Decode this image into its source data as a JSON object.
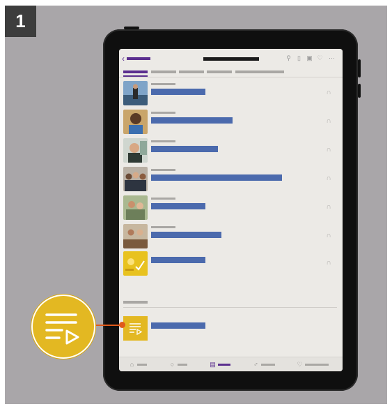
{
  "step": {
    "number": "1"
  },
  "colors": {
    "background": "#a9a6a9",
    "accent": "#5b2f8f",
    "title_placeholder": "#4b6aad",
    "highlight": "#e3b822",
    "callout_line": "#e05a1a"
  },
  "topbar": {
    "icons": [
      "back-chevron-icon",
      "search-icon",
      "bookmark-icon",
      "cast-icon",
      "lightbulb-icon",
      "more-icon"
    ]
  },
  "episodes": [
    {
      "thumb": "person-outdoors"
    },
    {
      "thumb": "man-smiling"
    },
    {
      "thumb": "woman-smiling"
    },
    {
      "thumb": "group-of-people"
    },
    {
      "thumb": "people-talking"
    },
    {
      "thumb": "people-at-table"
    },
    {
      "thumb": "yellow-illustration"
    }
  ],
  "playlist": {
    "icon": "playlist-icon"
  },
  "bottomnav": {
    "items": [
      {
        "icon": "home-icon",
        "active": false
      },
      {
        "icon": "comment-icon",
        "active": false
      },
      {
        "icon": "library-icon",
        "active": true
      },
      {
        "icon": "people-icon",
        "active": false
      },
      {
        "icon": "lightbulb-icon",
        "active": false
      }
    ]
  }
}
